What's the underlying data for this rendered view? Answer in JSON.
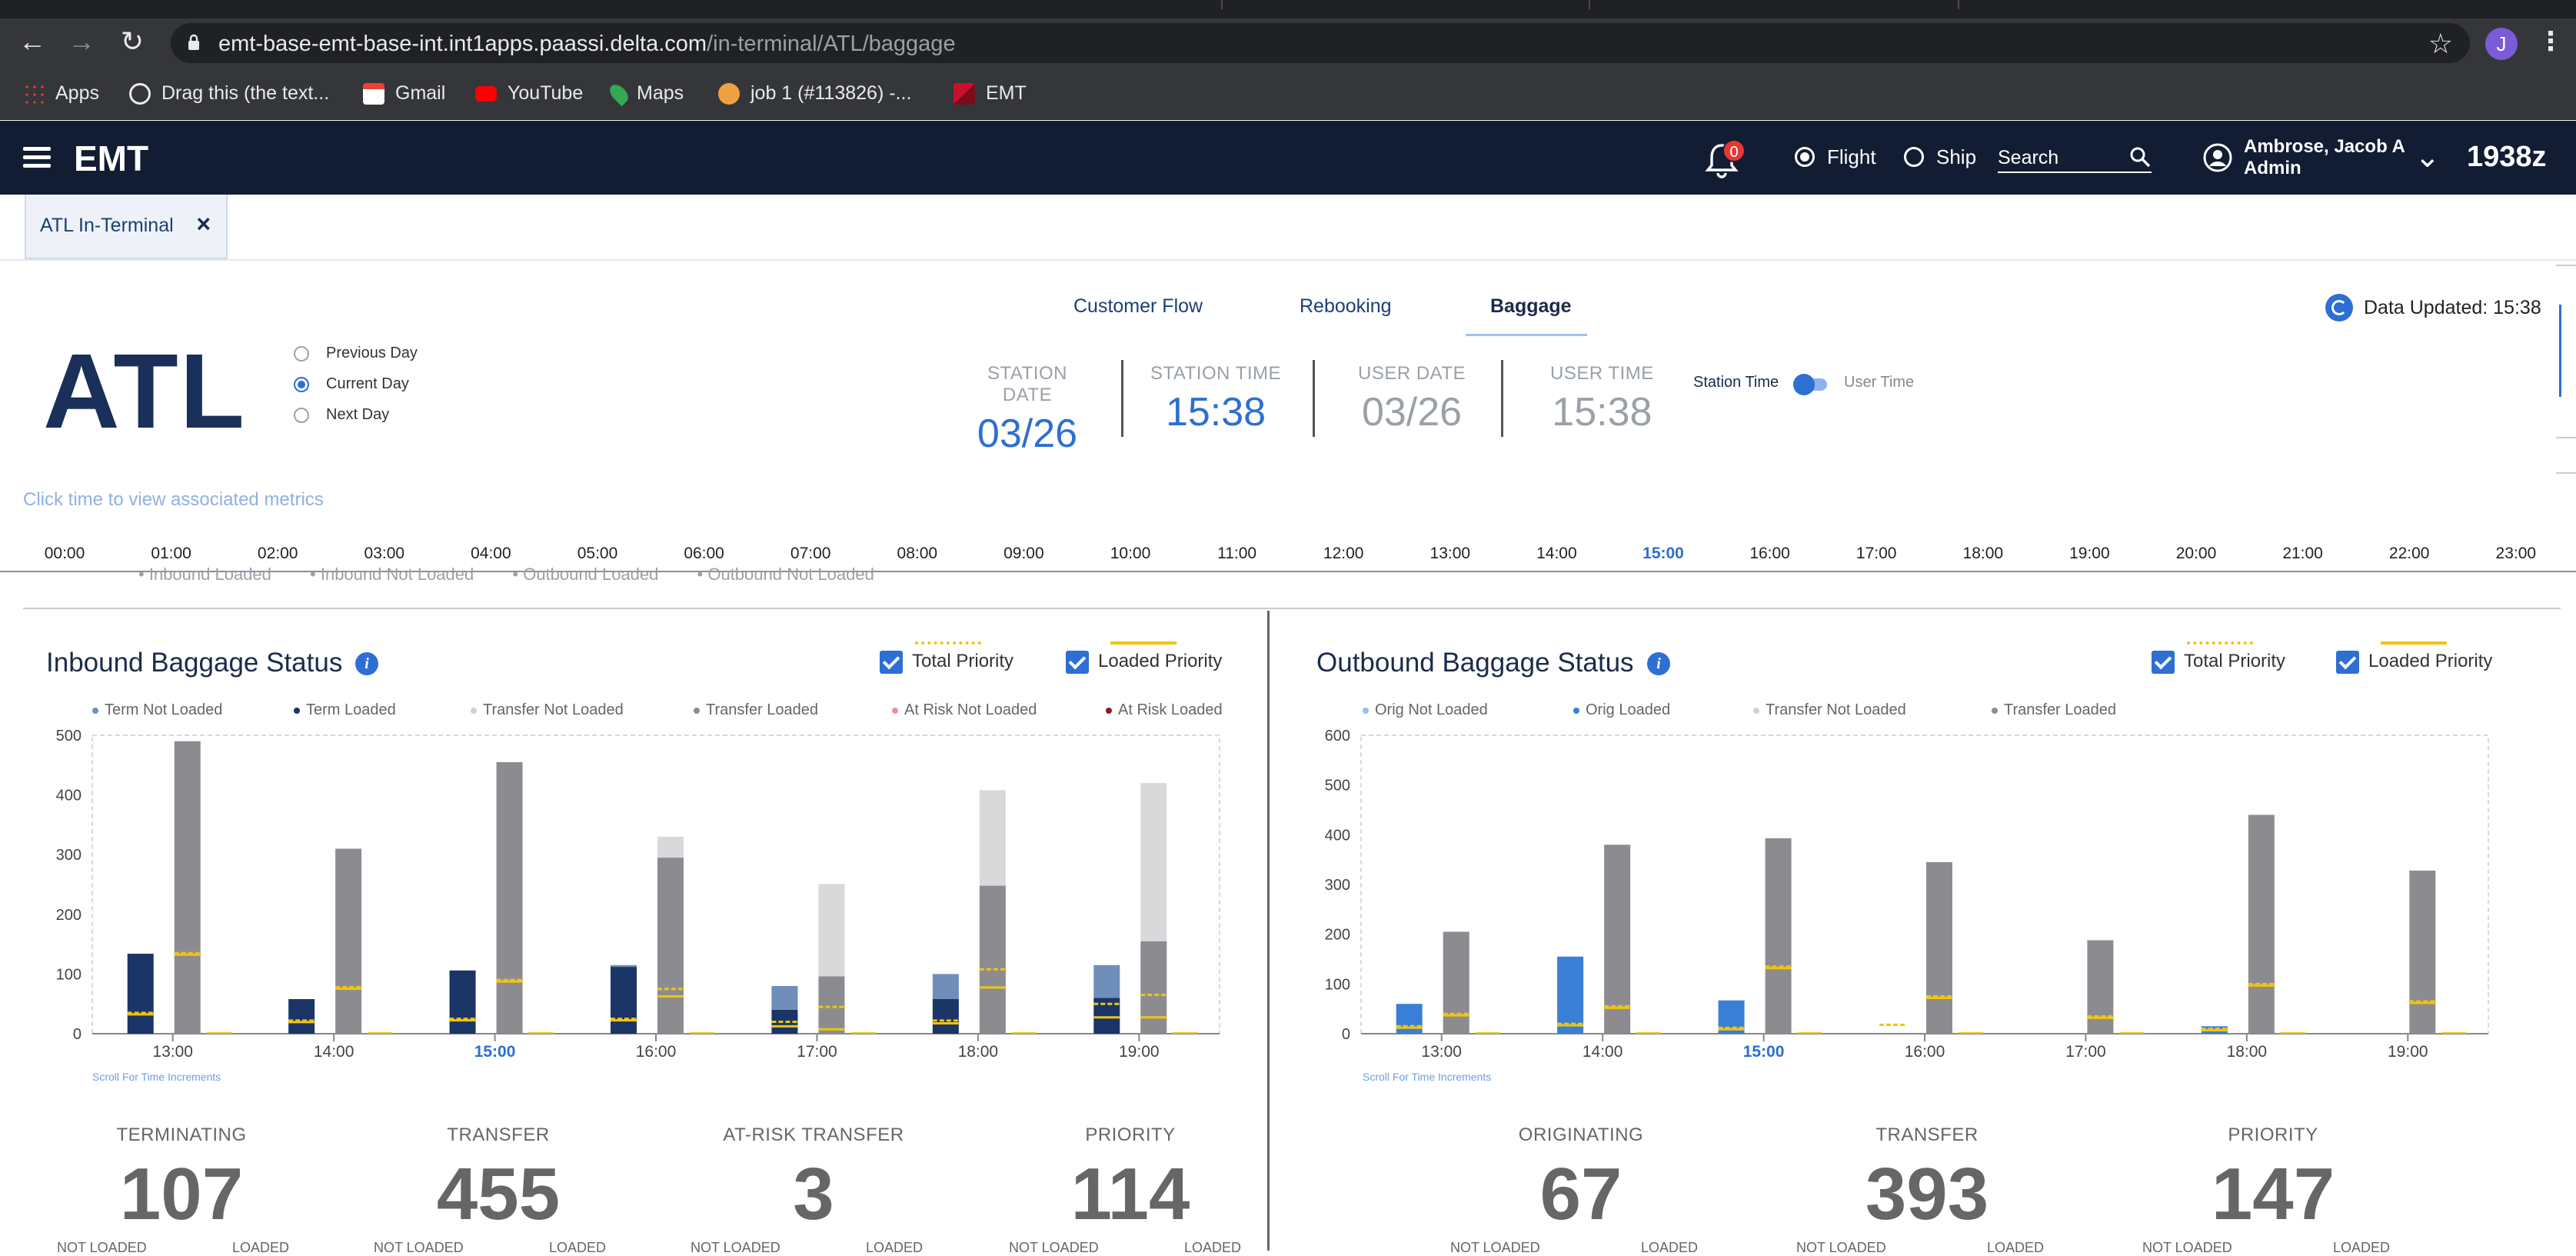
{
  "browser": {
    "url_host": "emt-base-emt-base-int.int1apps.paassi.delta.com",
    "url_path": "/in-terminal/ATL/baggage",
    "profile_initial": "J",
    "bookmarks": [
      "Apps",
      "Drag this (the text...",
      "Gmail",
      "YouTube",
      "Maps",
      "job 1 (#113826) -...",
      "EMT"
    ]
  },
  "header": {
    "app_name": "EMT",
    "notifications": "0",
    "mode_flight": "Flight",
    "mode_ship": "Ship",
    "search_placeholder": "Search",
    "user_name": "Ambrose, Jacob A",
    "user_role": "Admin",
    "zulu_time": "1938z"
  },
  "app_tab": {
    "label": "ATL In-Terminal",
    "close": "×"
  },
  "section_tabs": [
    "Customer Flow",
    "Rebooking",
    "Baggage"
  ],
  "data_updated": "Data Updated: 15:38",
  "station": {
    "code": "ATL",
    "day_options": [
      "Previous Day",
      "Current Day",
      "Next Day"
    ],
    "selected_day": "Current Day",
    "station_date_label": "STATION DATE",
    "station_date": "03/26",
    "station_time_label": "STATION TIME",
    "station_time": "15:38",
    "user_date_label": "USER DATE",
    "user_date": "03/26",
    "user_time_label": "USER TIME",
    "user_time": "15:38",
    "toggle_left": "Station Time",
    "toggle_right": "User Time"
  },
  "timeline": {
    "hint": "Click time to view associated metrics",
    "hours": [
      "00:00",
      "01:00",
      "02:00",
      "03:00",
      "04:00",
      "05:00",
      "06:00",
      "07:00",
      "08:00",
      "09:00",
      "10:00",
      "11:00",
      "12:00",
      "13:00",
      "14:00",
      "15:00",
      "16:00",
      "17:00",
      "18:00",
      "19:00",
      "20:00",
      "21:00",
      "22:00",
      "23:00"
    ],
    "current": "15:00"
  },
  "cut_legend": [
    "Inbound Loaded",
    "Inbound Not Loaded",
    "Outbound Loaded",
    "Outbound Not Loaded"
  ],
  "inbound": {
    "title": "Inbound Baggage Status",
    "check_total": "Total Priority",
    "check_loaded": "Loaded Priority",
    "scroll_hint": "Scroll For Time Increments",
    "kpis": [
      {
        "label": "TERMINATING",
        "value": "107"
      },
      {
        "label": "TRANSFER",
        "value": "455"
      },
      {
        "label": "AT-RISK TRANSFER",
        "value": "3"
      },
      {
        "label": "PRIORITY",
        "value": "114"
      }
    ],
    "kpi_sub": [
      "NOT LOADED",
      "LOADED"
    ]
  },
  "outbound": {
    "title": "Outbound Baggage Status",
    "check_total": "Total Priority",
    "check_loaded": "Loaded Priority",
    "scroll_hint": "Scroll For Time Increments",
    "kpis": [
      {
        "label": "ORIGINATING",
        "value": "67"
      },
      {
        "label": "TRANSFER",
        "value": "393"
      },
      {
        "label": "PRIORITY",
        "value": "147"
      }
    ],
    "kpi_sub": [
      "NOT LOADED",
      "LOADED"
    ]
  },
  "colors": {
    "term_not_loaded": "#6f8fba",
    "term_loaded": "#1a3566",
    "transfer_not_loaded": "#d9d9db",
    "transfer_loaded": "#8c8c90",
    "at_risk_not_loaded": "#f28b96",
    "at_risk_loaded": "#8b1a2b",
    "orig_not_loaded": "#8cc1f0",
    "orig_loaded": "#3a7fd6",
    "priority": "#f1c40f"
  },
  "chart_data": [
    {
      "type": "bar",
      "title": "Inbound Baggage Status",
      "categories": [
        "13:00",
        "14:00",
        "15:00",
        "16:00",
        "17:00",
        "18:00",
        "19:00"
      ],
      "highlight_category": "15:00",
      "ylim": [
        0,
        500
      ],
      "yticks": [
        0,
        100,
        200,
        300,
        400,
        500
      ],
      "legend": [
        "Term Not Loaded",
        "Term Loaded",
        "Transfer Not Loaded",
        "Transfer Loaded",
        "At Risk Not Loaded",
        "At Risk Loaded"
      ],
      "series": [
        {
          "name": "Term Not Loaded",
          "values": [
            0,
            0,
            0,
            3,
            40,
            42,
            55
          ],
          "color_key": "term_not_loaded"
        },
        {
          "name": "Term Loaded",
          "values": [
            134,
            58,
            106,
            112,
            40,
            58,
            60
          ],
          "color_key": "term_loaded"
        },
        {
          "name": "Transfer Not Loaded",
          "values": [
            0,
            0,
            0,
            35,
            155,
            160,
            265
          ],
          "color_key": "transfer_not_loaded"
        },
        {
          "name": "Transfer Loaded",
          "values": [
            490,
            310,
            455,
            295,
            96,
            248,
            155
          ],
          "color_key": "transfer_loaded"
        }
      ],
      "total_priority_term": [
        35,
        22,
        25,
        25,
        20,
        22,
        50
      ],
      "total_priority_transfer": [
        135,
        78,
        90,
        75,
        45,
        108,
        65
      ],
      "loaded_priority_term": [
        35,
        22,
        25,
        25,
        15,
        20,
        30
      ],
      "loaded_priority_transfer": [
        135,
        78,
        90,
        65,
        10,
        80,
        30
      ]
    },
    {
      "type": "bar",
      "title": "Outbound Baggage Status",
      "categories": [
        "13:00",
        "14:00",
        "15:00",
        "16:00",
        "17:00",
        "18:00",
        "19:00"
      ],
      "highlight_category": "15:00",
      "ylim": [
        0,
        600
      ],
      "yticks": [
        0,
        100,
        200,
        300,
        400,
        500,
        600
      ],
      "legend": [
        "Orig Not Loaded",
        "Orig Loaded",
        "Transfer Not Loaded",
        "Transfer Loaded"
      ],
      "series": [
        {
          "name": "Orig Not Loaded",
          "values": [
            0,
            0,
            0,
            0,
            0,
            0,
            0
          ],
          "color_key": "orig_not_loaded"
        },
        {
          "name": "Orig Loaded",
          "values": [
            60,
            155,
            67,
            0,
            0,
            15,
            0
          ],
          "color_key": "orig_loaded"
        },
        {
          "name": "Transfer Not Loaded",
          "values": [
            0,
            0,
            0,
            0,
            0,
            0,
            0
          ],
          "color_key": "transfer_not_loaded"
        },
        {
          "name": "Transfer Loaded",
          "values": [
            205,
            380,
            393,
            345,
            188,
            440,
            328
          ],
          "color_key": "transfer_loaded"
        }
      ],
      "total_priority_orig": [
        15,
        20,
        12,
        18,
        0,
        10,
        0
      ],
      "total_priority_transfer": [
        40,
        55,
        135,
        75,
        35,
        100,
        65
      ],
      "loaded_priority_orig": [
        15,
        20,
        12,
        0,
        0,
        10,
        0
      ],
      "loaded_priority_transfer": [
        40,
        55,
        135,
        75,
        35,
        100,
        65
      ]
    }
  ]
}
